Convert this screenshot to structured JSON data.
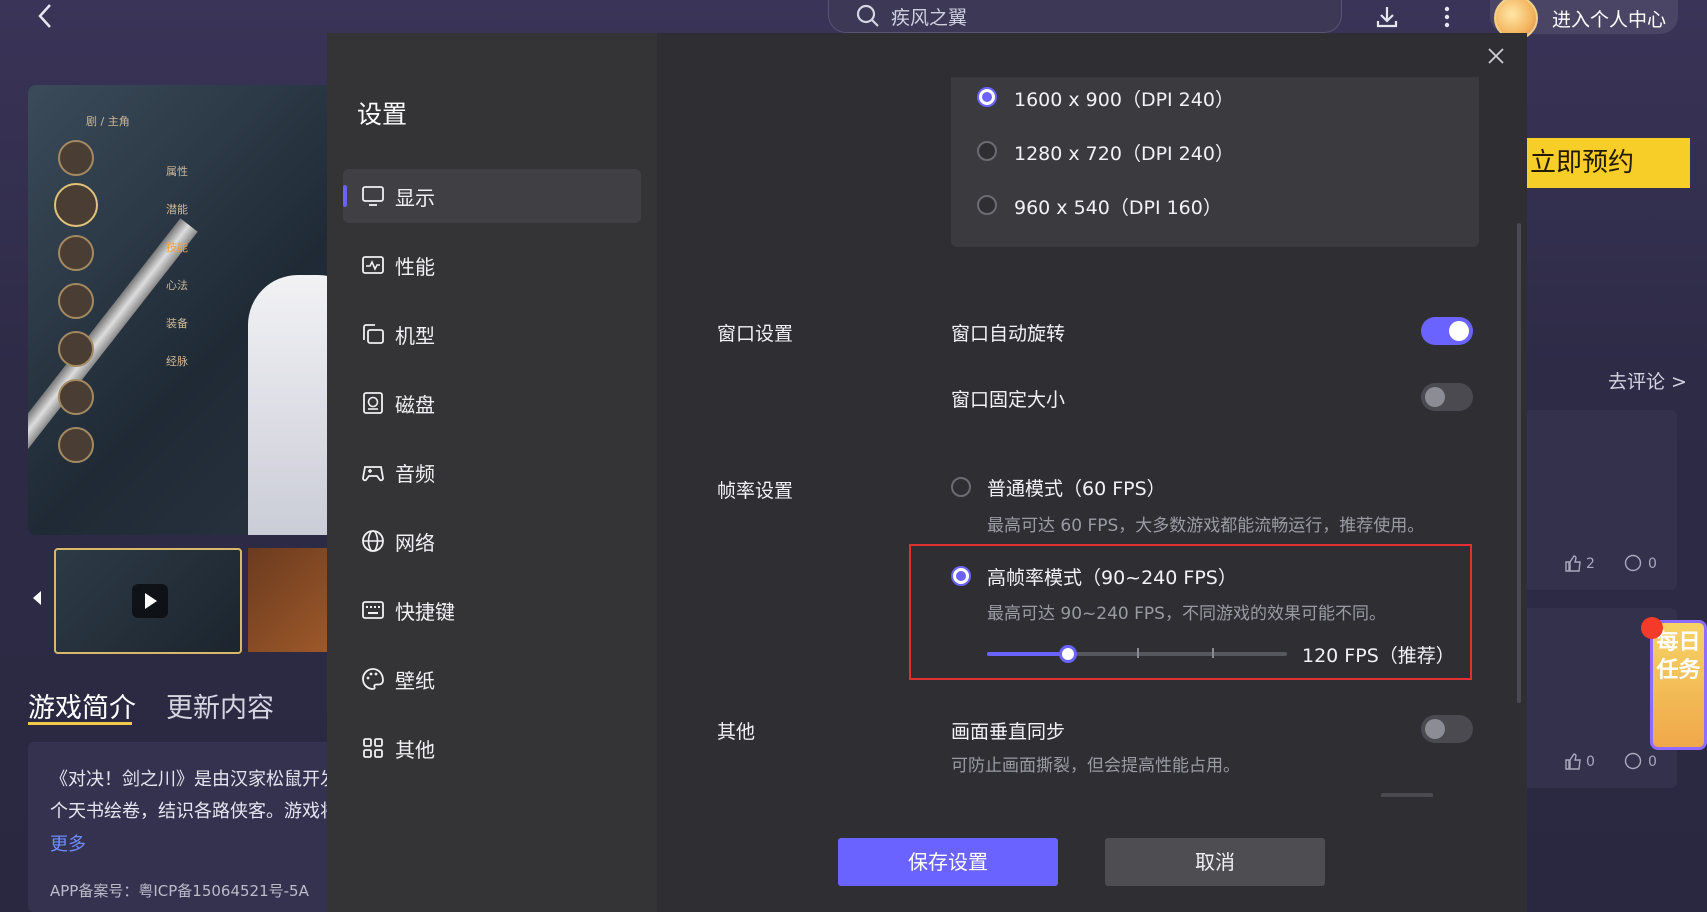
{
  "topbar": {
    "search_text": "疾风之翼",
    "user_label": "进入个人中心"
  },
  "background": {
    "tabs": {
      "intro": "游戏简介",
      "update": "更新内容"
    },
    "description": "《对决！剑之川》是由汉家松鼠开发的，个天书绘卷，结识各路侠客。游戏将",
    "description_line1": "《对决！剑之川》是由汉家松鼠开发",
    "description_line2": "个天书绘卷，结识各路侠客。游戏将",
    "more": "更多",
    "icp": "APP备案号：粤ICP备15064521号-5A",
    "reserve": "立即预约",
    "comment_link": "去评论 >",
    "card1": {
      "likes": "2",
      "comments": "0"
    },
    "card2": {
      "likes": "0",
      "comments": "0"
    },
    "daily_task": "每日任务",
    "hero_menu": [
      "剧 / 主角",
      "属性",
      "潜能",
      "技能",
      "心法",
      "装备",
      "经脉"
    ]
  },
  "modal": {
    "title": "设置",
    "nav": [
      {
        "label": "显示",
        "icon": "monitor-icon",
        "active": true
      },
      {
        "label": "性能",
        "icon": "performance-icon"
      },
      {
        "label": "机型",
        "icon": "device-model-icon"
      },
      {
        "label": "磁盘",
        "icon": "disk-icon"
      },
      {
        "label": "音频",
        "icon": "gamepad-audio-icon"
      },
      {
        "label": "网络",
        "icon": "globe-icon"
      },
      {
        "label": "快捷键",
        "icon": "keyboard-icon"
      },
      {
        "label": "壁纸",
        "icon": "palette-icon"
      },
      {
        "label": "其他",
        "icon": "grid-icon"
      }
    ],
    "resolutions": [
      {
        "label": "1600 x 900（DPI 240）",
        "selected": true
      },
      {
        "label": "1280 x 720（DPI 240）",
        "selected": false
      },
      {
        "label": "960 x 540（DPI 160）",
        "selected": false
      }
    ],
    "window": {
      "section": "窗口设置",
      "auto_rotate": {
        "label": "窗口自动旋转",
        "on": true
      },
      "fixed_size": {
        "label": "窗口固定大小",
        "on": false
      }
    },
    "framerate": {
      "section": "帧率设置",
      "normal": {
        "label": "普通模式（60 FPS）",
        "sub": "最高可达 60 FPS，大多数游戏都能流畅运行，推荐使用。",
        "selected": false
      },
      "high": {
        "label": "高帧率模式（90~240 FPS）",
        "sub": "最高可达 90~240 FPS，不同游戏的效果可能不同。",
        "selected": true
      },
      "slider_value": "120 FPS（推荐）",
      "slider_fraction": 0.27
    },
    "other": {
      "section": "其他",
      "vsync": {
        "label": "画面垂直同步",
        "sub": "可防止画面撕裂，但会提高性能占用。",
        "on": false
      }
    },
    "buttons": {
      "save": "保存设置",
      "cancel": "取消"
    }
  },
  "colors": {
    "accent": "#6a63ff",
    "highlight": "#e03030",
    "reserve": "#f7cd28"
  }
}
